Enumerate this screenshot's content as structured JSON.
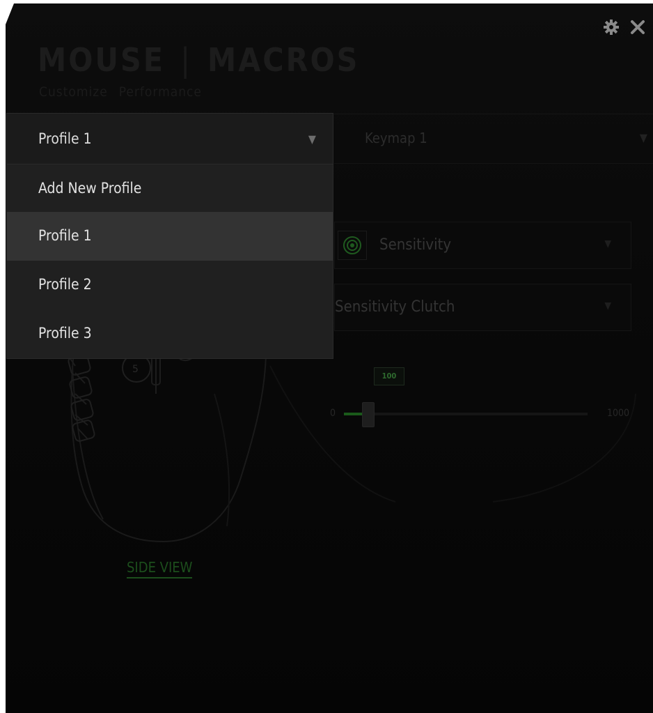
{
  "window": {
    "nav": {
      "item1": "MOUSE",
      "separator": "|",
      "item2": "MACROS"
    },
    "subnav": {
      "item1": "Customize",
      "item2": "Performance"
    },
    "top_icons": [
      "gear-icon",
      "close-icon"
    ]
  },
  "profile": {
    "selected": "Profile 1",
    "menu": [
      "Add New Profile",
      "Profile 1",
      "Profile 2",
      "Profile 3"
    ],
    "highlighted_index": 1
  },
  "keymap": {
    "selected": "Keymap 1"
  },
  "sensitivity_select": {
    "label": "Sensitivity"
  },
  "clutch_select": {
    "label": "Sensitivity Clutch"
  },
  "slider": {
    "value": "100",
    "min": "0",
    "max": "1000",
    "fraction": 0.1
  },
  "mouse": {
    "button_label": "5"
  },
  "side_view": {
    "label": "SIDE VIEW"
  },
  "colors": {
    "accent": "#44d62c",
    "dim_green": "#1c4e1c"
  }
}
